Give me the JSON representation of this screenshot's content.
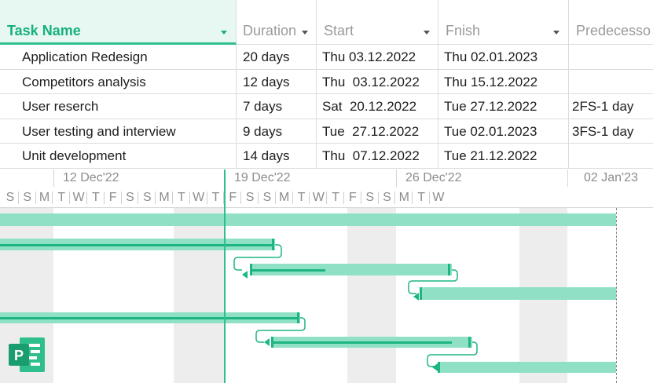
{
  "columns": {
    "task": "Task Name",
    "duration": "Duration",
    "start": "Start",
    "finish": "Fnish",
    "predecessors": "Predecesso"
  },
  "tasks": [
    {
      "name": "Application Redesign",
      "duration": "20 days",
      "start": "Thu 03.12.2022",
      "finish": "Thu 02.01.2023",
      "predecessor": ""
    },
    {
      "name": "Competitors analysis",
      "duration": "12 days",
      "start": "Thu  03.12.2022",
      "finish": "Thu 15.12.2022",
      "predecessor": ""
    },
    {
      "name": "User reserch",
      "duration": "7 days",
      "start": "Sat  20.12.2022",
      "finish": "Tue 27.12.2022",
      "predecessor": "2FS-1 day"
    },
    {
      "name": "User testing and interview",
      "duration": "9 days",
      "start": "Tue  27.12.2022",
      "finish": "Tue 02.01.2023",
      "predecessor": "3FS-1 day"
    },
    {
      "name": "Unit development",
      "duration": "14 days",
      "start": "Thu  07.12.2022",
      "finish": "Tue 21.12.2022",
      "predecessor": ""
    }
  ],
  "timeline": {
    "weeks": [
      "12 Dec'22",
      "19 Dec'22",
      "26 Dec'22",
      "02 Jan'23"
    ],
    "days": [
      "S",
      "S",
      "M",
      "T",
      "W",
      "T",
      "F",
      "S",
      "S",
      "M",
      "T",
      "W",
      "T",
      "F",
      "S",
      "S",
      "M",
      "T",
      "W",
      "T",
      "F",
      "S",
      "S",
      "M",
      "T",
      "W"
    ]
  },
  "colors": {
    "accent": "#17b07e",
    "bar": "#8fe0c5",
    "progress": "#1db584",
    "header_bg": "#e6f8f1",
    "weekend": "#ededed"
  },
  "icons": {
    "app_logo": "microsoft-project-icon"
  }
}
